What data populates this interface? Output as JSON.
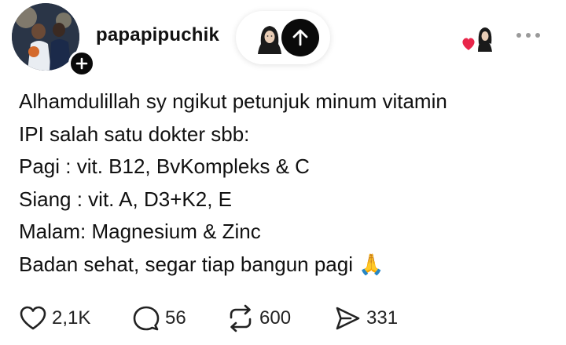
{
  "post": {
    "username": "papapipuchik",
    "lines": [
      "Alhamdulillah sy ngikut petunjuk minum vitamin",
      "IPI salah satu dokter sbb:",
      "Pagi : vit. B12, BvKompleks & C",
      "Siang : vit. A, D3+K2, E",
      "Malam: Magnesium & Zinc",
      "Badan sehat, segar tiap bangun pagi"
    ],
    "trailing_emoji": "🙏"
  },
  "actions": {
    "likes": "2,1K",
    "replies": "56",
    "reposts": "600",
    "shares": "331"
  },
  "icons": {
    "follow": "plus-icon",
    "scroll_up": "arrow-up-icon",
    "reaction": "heart-avatar-icon",
    "more": "more-dots-icon",
    "like": "heart-outline-icon",
    "reply": "speech-bubble-icon",
    "repost": "repost-arrows-icon",
    "share": "send-icon"
  },
  "colors": {
    "text": "#111111",
    "reaction_heart": "#e8264a",
    "button_dark": "#0a0a0a"
  }
}
